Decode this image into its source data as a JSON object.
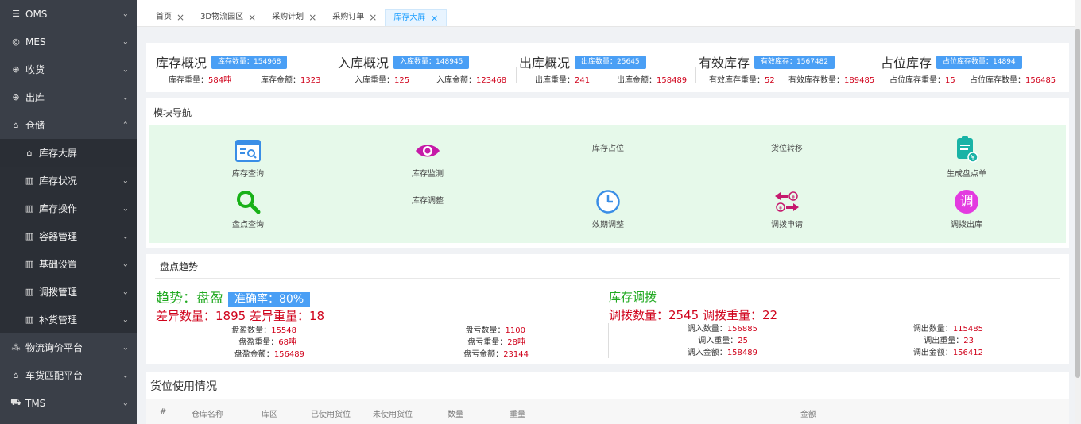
{
  "sidebar": {
    "items": [
      {
        "label": "OMS",
        "icon": "list-icon"
      },
      {
        "label": "MES",
        "icon": "target-icon"
      },
      {
        "label": "收货",
        "icon": "box-icon"
      },
      {
        "label": "出库",
        "icon": "box-icon"
      },
      {
        "label": "仓储",
        "icon": "home-icon"
      },
      {
        "label": "库存大屏",
        "icon": "home-icon"
      },
      {
        "label": "库存状况",
        "icon": "grid-icon"
      },
      {
        "label": "库存操作",
        "icon": "grid-icon"
      },
      {
        "label": "容器管理",
        "icon": "grid-icon"
      },
      {
        "label": "基础设置",
        "icon": "grid-icon"
      },
      {
        "label": "调拨管理",
        "icon": "grid-icon"
      },
      {
        "label": "补货管理",
        "icon": "grid-icon"
      },
      {
        "label": "物流询价平台",
        "icon": "nodes-icon"
      },
      {
        "label": "车货匹配平台",
        "icon": "home-icon"
      },
      {
        "label": "TMS",
        "icon": "truck-icon"
      }
    ]
  },
  "tabs": [
    {
      "label": "首页"
    },
    {
      "label": "3D物流园区"
    },
    {
      "label": "采购计划"
    },
    {
      "label": "采购订单"
    },
    {
      "label": "库存大屏"
    }
  ],
  "summary": [
    {
      "title": "库存概况",
      "badge": "库存数量：154968",
      "k1": "库存重量：",
      "v1": "584吨",
      "k2": "库存金额：",
      "v2": "1323"
    },
    {
      "title": "入库概况",
      "badge": "入库数量：148945",
      "k1": "入库重量：",
      "v1": "125",
      "k2": "入库金额：",
      "v2": "123468"
    },
    {
      "title": "出库概况",
      "badge": "出库数量：25645",
      "k1": "出库重量：",
      "v1": "241",
      "k2": "出库金额：",
      "v2": "158489"
    },
    {
      "title": "有效库存",
      "badge": "有效库存：1567482",
      "k1": "有效库存重量：",
      "v1": "52",
      "k2": "有效库存数量：",
      "v2": "189485"
    },
    {
      "title": "占位库存",
      "badge": "占位库存数量：14894",
      "k1": "占位库存重量：",
      "v1": "15",
      "k2": "占位库存数量：",
      "v2": "156485"
    }
  ],
  "nav": {
    "title": "模块导航",
    "items": [
      {
        "label": "库存查询",
        "icon": "search-window-icon"
      },
      {
        "label": "库存监测",
        "icon": "eye-icon"
      },
      {
        "label": "库存占位",
        "icon": ""
      },
      {
        "label": "货位转移",
        "icon": ""
      },
      {
        "label": "生成盘点单",
        "icon": "clipboard-icon"
      },
      {
        "label": "盘点查询",
        "icon": "magnifier-icon"
      },
      {
        "label": "库存调整",
        "icon": ""
      },
      {
        "label": "效期调整",
        "icon": "clock-icon"
      },
      {
        "label": "调拨申请",
        "icon": "exchange-icon"
      },
      {
        "label": "调拨出库",
        "icon": "transfer-circle-icon",
        "glyph": "调"
      }
    ]
  },
  "trend": {
    "title": "盘点趋势",
    "left": {
      "headline": "趋势：盘盈",
      "accuracy": "准确率：80%",
      "diff": "差异数量：1895 差异重量：18",
      "rows": [
        {
          "k": "盘盈数量：",
          "v": "15548"
        },
        {
          "k": "盘盈重量：",
          "v": "68吨"
        },
        {
          "k": "盘盈金额：",
          "v": "156489"
        }
      ],
      "rows2": [
        {
          "k": "盘亏数量：",
          "v": "1100"
        },
        {
          "k": "盘亏重量：",
          "v": "28吨"
        },
        {
          "k": "盘亏金额：",
          "v": "23144"
        }
      ]
    },
    "right": {
      "headline": "库存调拨",
      "diff": "调拨数量：2545 调拨重量：22",
      "rows": [
        {
          "k": "调入数量：",
          "v": "156885"
        },
        {
          "k": "调入重量：",
          "v": "25"
        },
        {
          "k": "调入金额：",
          "v": "158489"
        }
      ],
      "rows2": [
        {
          "k": "调出数量：",
          "v": "115485"
        },
        {
          "k": "调出重量：",
          "v": "23"
        },
        {
          "k": "调出金额：",
          "v": "156412"
        }
      ]
    }
  },
  "slots": {
    "title": "货位使用情况",
    "columns": [
      "#",
      "仓库名称",
      "库区",
      "已使用货位",
      "未使用货位",
      "数量",
      "重量",
      "金额"
    ]
  }
}
